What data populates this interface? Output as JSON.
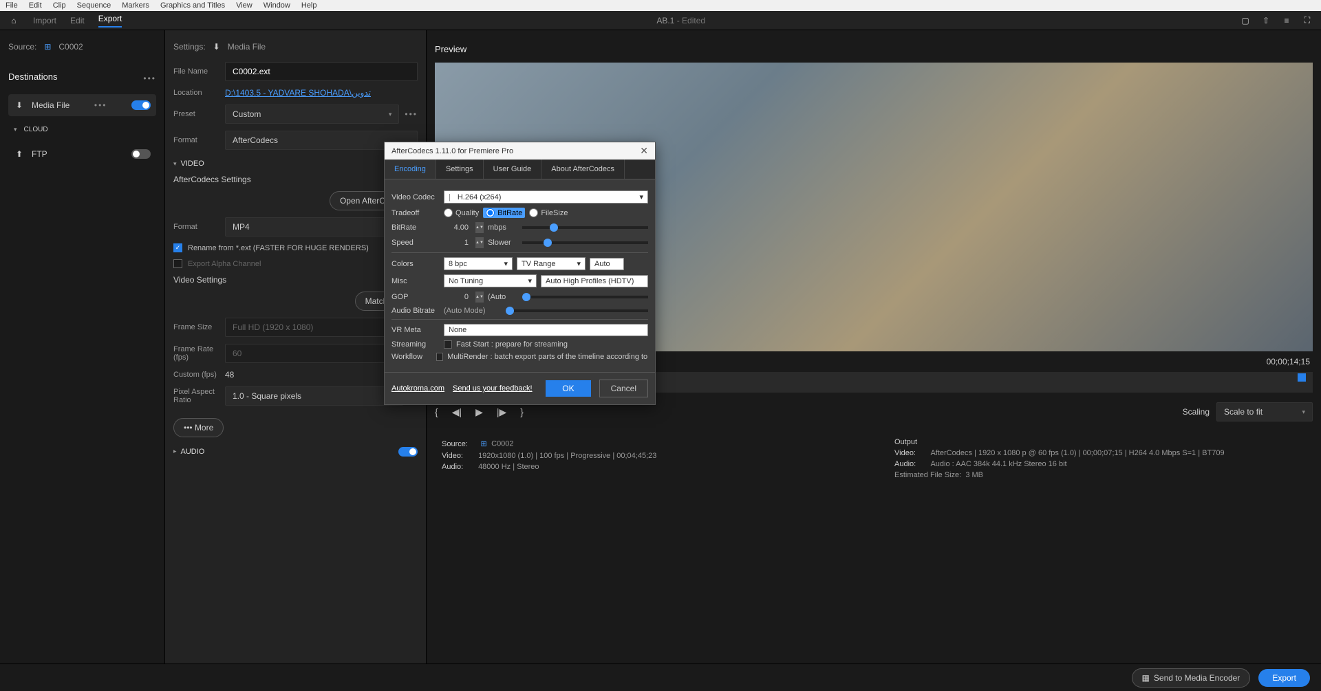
{
  "menu": {
    "file": "File",
    "edit": "Edit",
    "clip": "Clip",
    "sequence": "Sequence",
    "markers": "Markers",
    "graphics": "Graphics and Titles",
    "view": "View",
    "window": "Window",
    "help": "Help"
  },
  "toolbar": {
    "import": "Import",
    "edit": "Edit",
    "export": "Export",
    "title": "AB.1",
    "status": "- Edited"
  },
  "source": {
    "label": "Source:",
    "name": "C0002"
  },
  "destinations": {
    "heading": "Destinations",
    "mediaFile": "Media File",
    "cloud": "CLOUD",
    "ftp": "FTP"
  },
  "settings": {
    "heading": "Settings:",
    "mediaFile": "Media File",
    "fileName": {
      "label": "File Name",
      "value": "C0002.ext"
    },
    "location": {
      "label": "Location",
      "value": "D:\\1403.5 - YADVARE SHOHADA\\تدوين"
    },
    "preset": {
      "label": "Preset",
      "value": "Custom"
    },
    "format": {
      "label": "Format",
      "value": "AfterCodecs"
    },
    "videoSection": "VIDEO",
    "afterCodecsSettings": "AfterCodecs Settings",
    "openAfterCodecs": "Open AfterCodecs",
    "formatMP4": {
      "label": "Format",
      "value": "MP4"
    },
    "renameCheck": "Rename from *.ext (FASTER FOR HUGE RENDERS)",
    "exportAlpha": "Export Alpha Channel",
    "videoSettings": "Video Settings",
    "matchSource": "Match Sour",
    "frameSize": {
      "label": "Frame Size",
      "value": "Full HD (1920 x 1080)"
    },
    "frameRate": {
      "label": "Frame Rate (fps)",
      "value": "60"
    },
    "custom": {
      "label": "Custom (fps)",
      "value": "48"
    },
    "par": {
      "label": "Pixel Aspect Ratio",
      "value": "1.0 - Square pixels"
    },
    "more": "More",
    "audioSection": "AUDIO"
  },
  "preview": {
    "heading": "Preview",
    "timecode": "00;00;14;15",
    "scaling": {
      "label": "Scaling",
      "value": "Scale to fit"
    },
    "source": {
      "label": "Source:",
      "name": "C0002",
      "video": "Video:",
      "videoInfo": "1920x1080 (1.0) | 100 fps | Progressive | 00;04;45;23",
      "audio": "Audio:",
      "audioInfo": "48000 Hz | Stereo"
    },
    "output": {
      "label": "Output",
      "video": "Video:",
      "videoInfo": "AfterCodecs | 1920 x 1080 p @ 60 fps (1.0) | 00;00;07;15 | H264 4.0 Mbps S=1 | BT709",
      "audio": "Audio:",
      "audioInfo": "Audio : AAC 384k 44.1 kHz Stereo 16 bit",
      "size": "Estimated File Size:",
      "sizeVal": "3 MB"
    }
  },
  "footer": {
    "send": "Send to Media Encoder",
    "export": "Export"
  },
  "modal": {
    "title": "AfterCodecs 1.11.0 for Premiere Pro",
    "tabs": {
      "encoding": "Encoding",
      "settings": "Settings",
      "userGuide": "User Guide",
      "about": "About AfterCodecs"
    },
    "videoCodec": {
      "label": "Video Codec",
      "value": "H.264 (x264)"
    },
    "tradeoff": {
      "label": "Tradeoff",
      "quality": "Quality",
      "bitrate": "BitRate",
      "filesize": "FileSize"
    },
    "bitrate": {
      "label": "BitRate",
      "value": "4.00",
      "unit": "mbps"
    },
    "speed": {
      "label": "Speed",
      "value": "1",
      "unit": "Slower"
    },
    "colors": {
      "label": "Colors",
      "bpc": "8 bpc",
      "range": "TV Range",
      "auto": "Auto"
    },
    "misc": {
      "label": "Misc",
      "tuning": "No Tuning",
      "profile": "Auto High Profiles (HDTV)"
    },
    "gop": {
      "label": "GOP",
      "value": "0",
      "unit": "(Auto"
    },
    "audioBitrate": {
      "label": "Audio Bitrate",
      "value": "(Auto Mode)"
    },
    "vrMeta": {
      "label": "VR Meta",
      "value": "None"
    },
    "streaming": {
      "label": "Streaming",
      "desc": "Fast Start : prepare for streaming"
    },
    "workflow": {
      "label": "Workflow",
      "desc": "MultiRender : batch export parts of the timeline according to its markers"
    },
    "autokroma": "Autokroma.com",
    "feedback": "Send us your feedback!",
    "ok": "OK",
    "cancel": "Cancel"
  }
}
